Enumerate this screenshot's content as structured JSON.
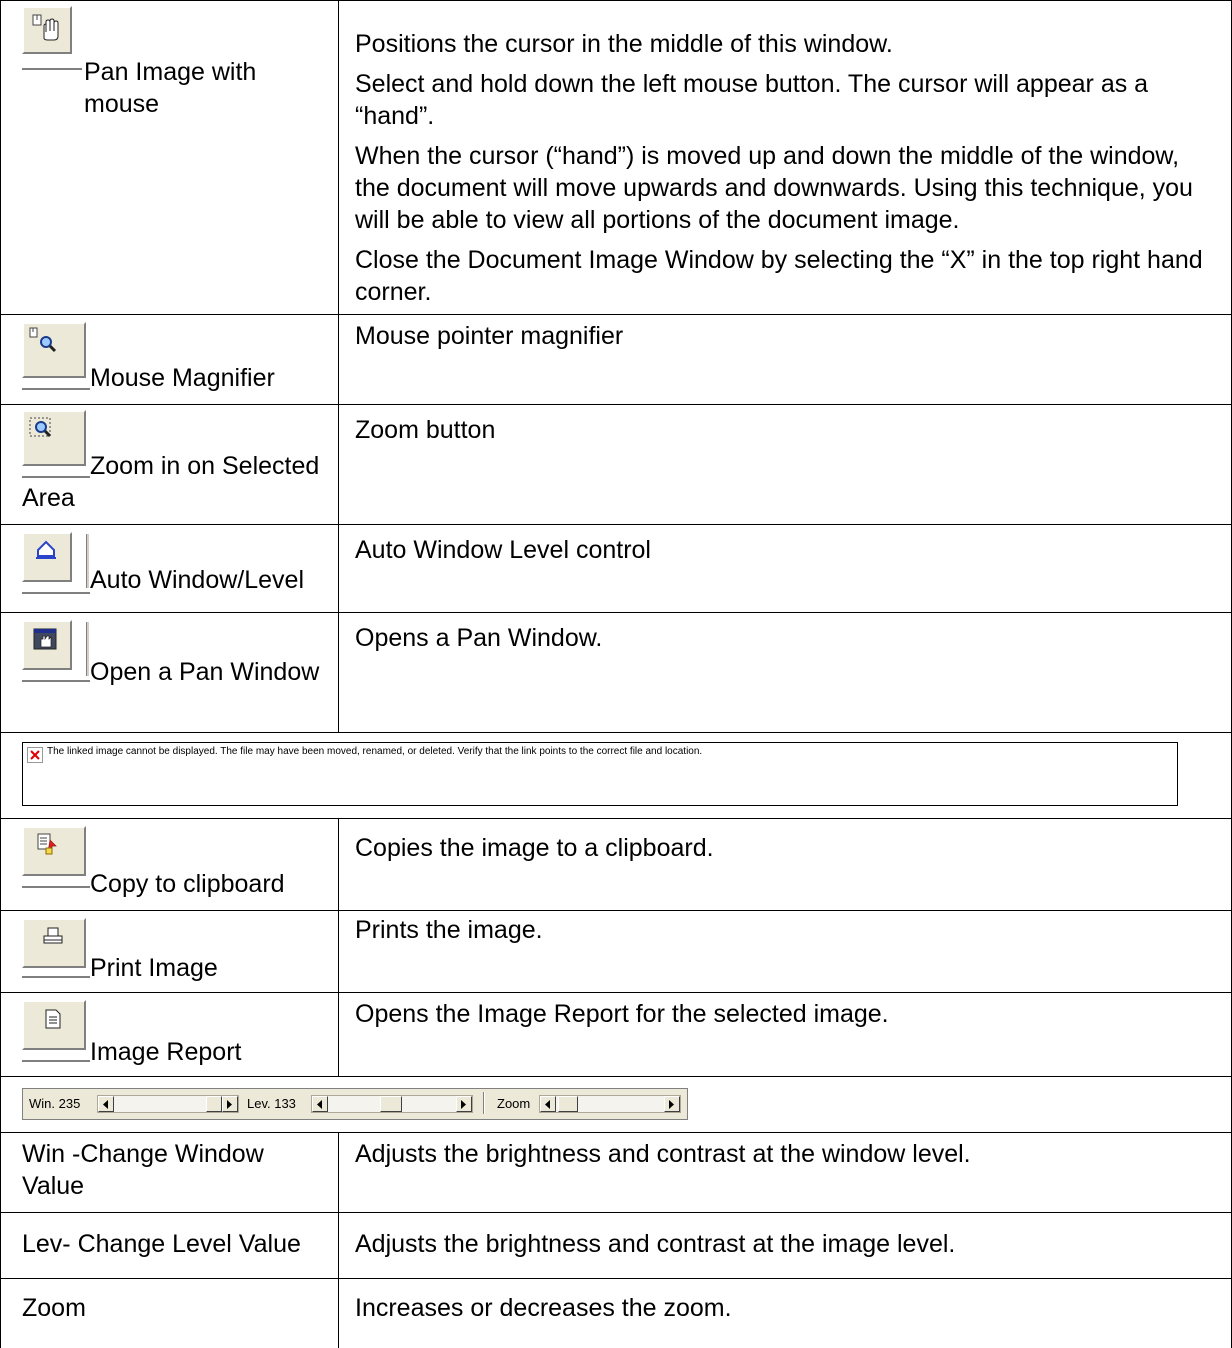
{
  "rows": [
    {
      "label": "Pan Image with mouse",
      "icon": "pan-hand-icon",
      "description": [
        "Positions the cursor in the middle of this window.",
        "Select and hold down the left mouse button. The cursor will appear as a “hand”.",
        "When the cursor (“hand”) is moved up and down the middle of the window, the document will move upwards and downwards. Using this technique, you will be able to view all portions of the document image.",
        "Close the Document Image Window by selecting the “X” in the top right hand corner."
      ]
    },
    {
      "label": "Mouse Magnifier",
      "icon": "mouse-magnifier-icon",
      "description": [
        "Mouse pointer magnifier"
      ]
    },
    {
      "label": "Zoom in on Selected Area",
      "icon": "zoom-area-icon",
      "description": [
        "Zoom button"
      ]
    },
    {
      "label": "Auto Window/Level",
      "icon": "auto-window-level-icon",
      "description": [
        "Auto Window Level control"
      ]
    },
    {
      "label": "Open a Pan Window",
      "icon": "pan-window-icon",
      "description": [
        "Opens a Pan Window."
      ]
    },
    {
      "label": "Copy to clipboard",
      "icon": "copy-clipboard-icon",
      "description": [
        "Copies the image to a clipboard."
      ]
    },
    {
      "label": "Print Image",
      "icon": "printer-icon",
      "description": [
        "Prints the image."
      ]
    },
    {
      "label": "Image Report",
      "icon": "report-icon",
      "description": [
        "Opens the Image Report for the selected image."
      ]
    }
  ],
  "broken_image_text": "The linked image cannot be displayed.  The file may have been moved, renamed, or deleted. Verify that the link points to the correct file and location.",
  "toolbar": {
    "win_label": "Win. 235",
    "lev_label": "Lev. 133",
    "zoom_label": "Zoom"
  },
  "text_rows": [
    {
      "label": "Win -Change Window Value",
      "description": "Adjusts the brightness and contrast at the window level."
    },
    {
      "label": "Lev- Change Level Value",
      "description": "Adjusts the brightness and contrast at the image level."
    },
    {
      "label": "Zoom",
      "description": "Increases or decreases the zoom."
    }
  ]
}
